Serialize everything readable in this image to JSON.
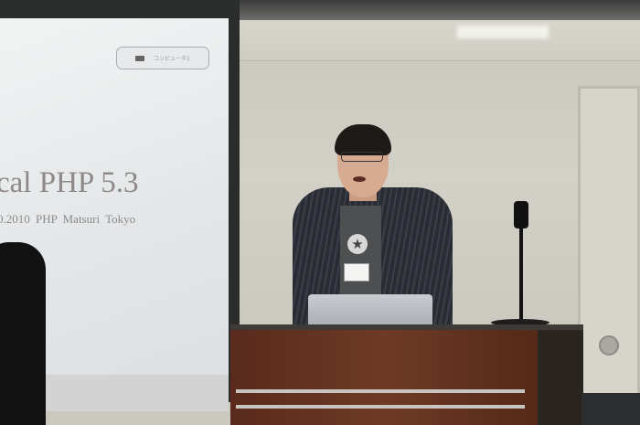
{
  "scene": {
    "description_free": true,
    "slide": {
      "indicator_label": "コンピュータ1",
      "title": "cal PHP 5.3",
      "subtitle": "0.2010  PHP Matsuri  Tokyo"
    }
  },
  "colors": {
    "wall": "#cbc9bf",
    "podium": "#6e3a26",
    "screen": "#e6e9eb"
  }
}
